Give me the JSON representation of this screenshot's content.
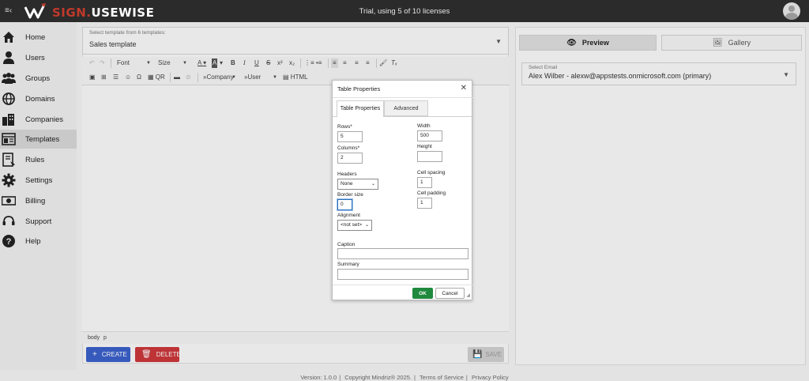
{
  "app": {
    "logo_primary": "SIGN.",
    "logo_secondary": "USEWISE",
    "license_status": "Trial, using 5 of 10 licenses"
  },
  "sidebar": {
    "items": [
      {
        "label": "Home",
        "icon": "home-icon"
      },
      {
        "label": "Users",
        "icon": "user-icon"
      },
      {
        "label": "Groups",
        "icon": "groups-icon"
      },
      {
        "label": "Domains",
        "icon": "globe-icon"
      },
      {
        "label": "Companies",
        "icon": "building-icon"
      },
      {
        "label": "Templates",
        "icon": "template-icon",
        "active": true
      },
      {
        "label": "Rules",
        "icon": "rules-icon"
      },
      {
        "label": "Settings",
        "icon": "gear-icon"
      },
      {
        "label": "Billing",
        "icon": "money-icon"
      },
      {
        "label": "Support",
        "icon": "support-icon"
      },
      {
        "label": "Help",
        "icon": "help-icon"
      }
    ]
  },
  "template_select": {
    "label": "Select template from 6 templates:",
    "value": "Sales template"
  },
  "editor_toolbar": {
    "font": "Font",
    "size": "Size",
    "company": "»Company",
    "user": "»User",
    "qr": "QR",
    "html": "HTML"
  },
  "statusbar": {
    "path1": "body",
    "path2": "p"
  },
  "actions": {
    "create": "CREATE",
    "delete": "DELETE",
    "save": "SAVE"
  },
  "preview_panel": {
    "preview_tab": "Preview",
    "gallery_tab": "Gallery",
    "email_label": "Select Email",
    "email_value": "Alex Wilber - alexw@appstests.onmicrosoft.com (primary)"
  },
  "footer": {
    "version": "Version: 1.0.0",
    "copyright": "Copyright Mindriz® 2025.",
    "terms": "Terms of Service",
    "privacy": "Privacy Policy"
  },
  "dialog": {
    "title": "Table Properties",
    "tabs": [
      "Table Properties",
      "Advanced"
    ],
    "rows_label": "Rows*",
    "rows_value": "5",
    "columns_label": "Columns*",
    "columns_value": "2",
    "headers_label": "Headers",
    "headers_value": "None",
    "border_label": "Border size",
    "border_value": "0",
    "alignment_label": "Alignment",
    "alignment_value": "<not set>",
    "width_label": "Width",
    "width_value": "500",
    "height_label": "Height",
    "height_value": "",
    "spacing_label": "Cell spacing",
    "spacing_value": "1",
    "padding_label": "Cell padding",
    "padding_value": "1",
    "caption_label": "Caption",
    "caption_value": "",
    "summary_label": "Summary",
    "summary_value": "",
    "ok": "OK",
    "cancel": "Cancel"
  }
}
